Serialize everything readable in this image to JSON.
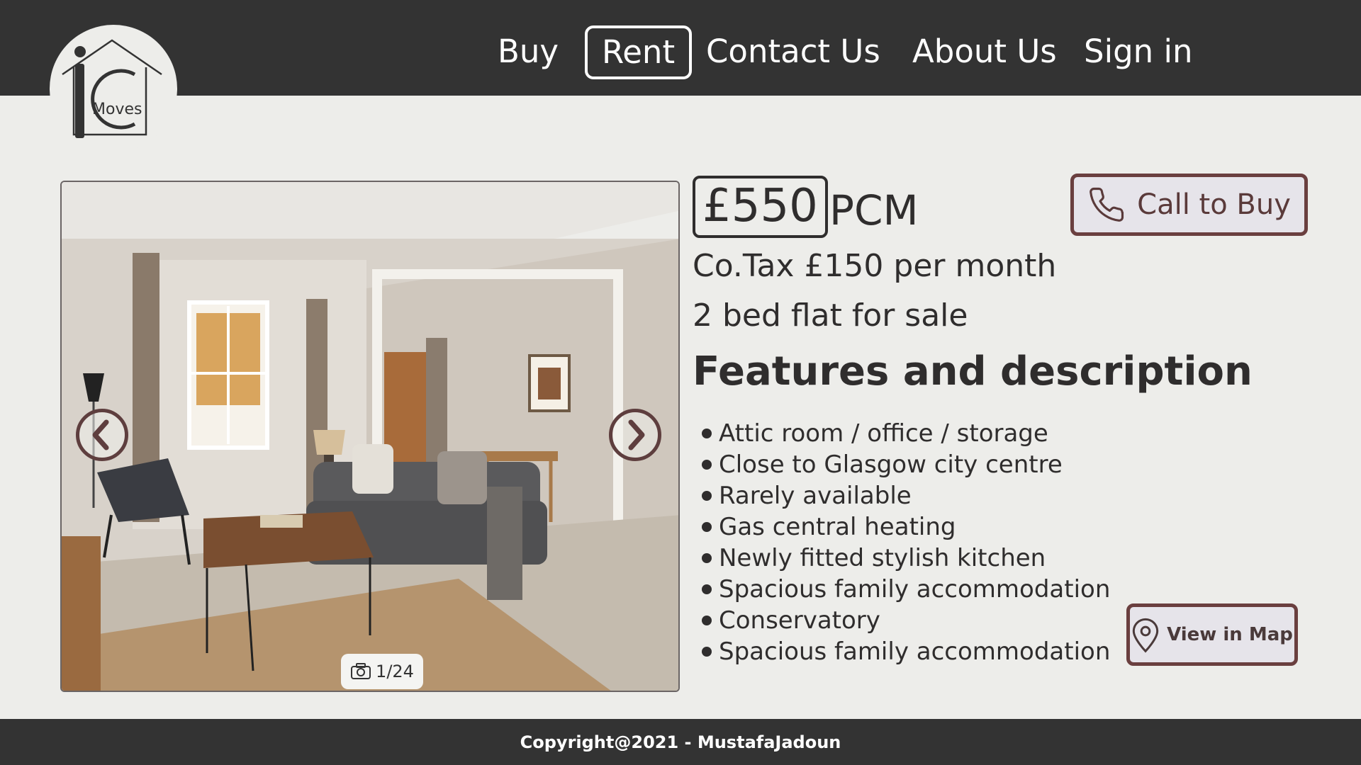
{
  "nav": {
    "items": [
      {
        "label": "Buy"
      },
      {
        "label": "Rent",
        "active": true
      },
      {
        "label": "Contact Us"
      },
      {
        "label": "About Us"
      },
      {
        "label": "Sign in"
      }
    ]
  },
  "logo": {
    "text": "Moves",
    "letter": "i",
    "icon": "house-logo-icon"
  },
  "gallery": {
    "counter": "1/24",
    "prev_icon": "chevron-left-icon",
    "next_icon": "chevron-right-icon",
    "camera_icon": "camera-icon"
  },
  "listing": {
    "price": "£550",
    "price_unit": "PCM",
    "council_tax": "Co.Tax £150 per month",
    "summary": "2 bed flat for sale",
    "features_heading": "Features and description",
    "features": [
      "Attic room / office / storage",
      "Close to Glasgow city centre",
      "Rarely available",
      "Gas central heating",
      "Newly fitted stylish kitchen",
      "Spacious family accommodation",
      "Conservatory",
      "Spacious family accommodation"
    ]
  },
  "actions": {
    "call_label": "Call to Buy",
    "call_icon": "phone-icon",
    "map_label": "View in Map",
    "map_icon": "map-pin-icon"
  },
  "footer": {
    "copyright": "Copyright@2021 - MustafaJadoun"
  },
  "colors": {
    "header_bg": "#333333",
    "page_bg": "#ededea",
    "accent_border": "#6a3f3f",
    "button_bg": "#e6e4ea"
  }
}
